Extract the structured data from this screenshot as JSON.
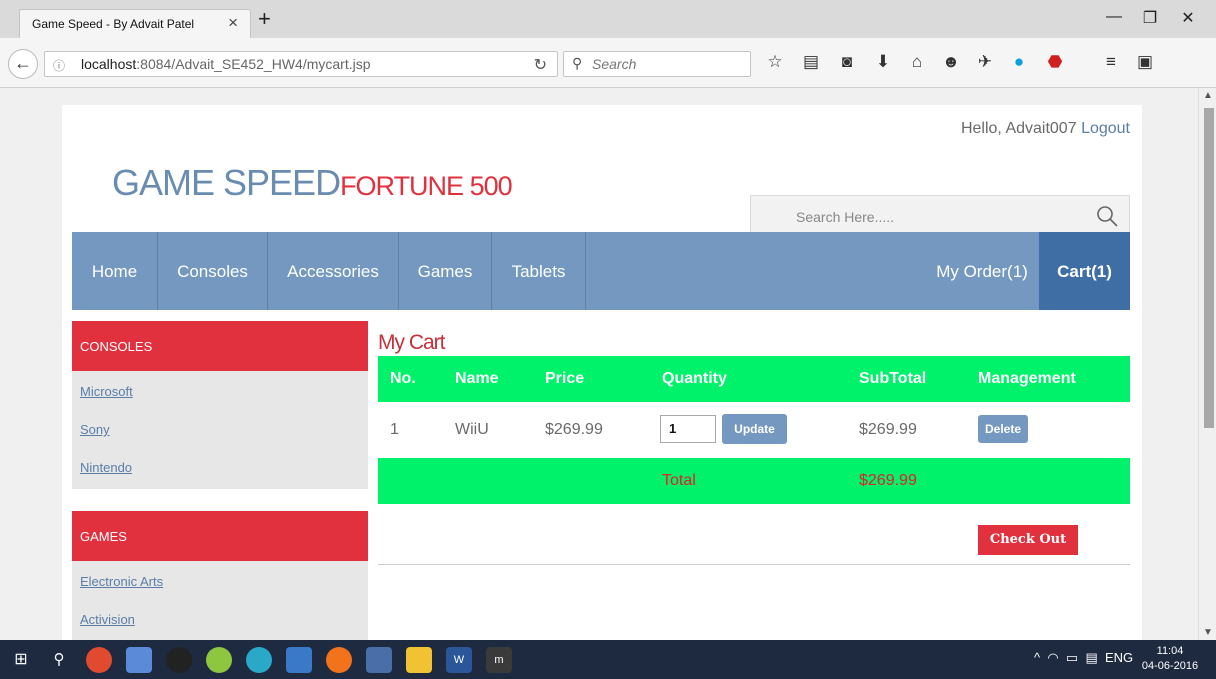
{
  "browser": {
    "tab_title": "Game Speed - By Advait Patel",
    "url_host": "localhost",
    "url_rest": ":8084/Advait_SE452_HW4/mycart.jsp",
    "search_placeholder": "Search"
  },
  "header": {
    "greeting": "Hello, Advait007",
    "logout": "Logout",
    "logo_main": "GAME SPEED",
    "logo_sub": "FORTUNE 500",
    "search_placeholder": "Search Here....."
  },
  "menu": {
    "items": [
      "Home",
      "Consoles",
      "Accessories",
      "Games",
      "Tablets"
    ],
    "my_order": "My Order(1)",
    "cart": "Cart(1)"
  },
  "sidebar": {
    "sections": [
      {
        "title": "CONSOLES",
        "links": [
          "Microsoft",
          "Sony",
          "Nintendo"
        ]
      },
      {
        "title": "GAMES",
        "links": [
          "Electronic Arts",
          "Activision"
        ]
      }
    ]
  },
  "cart": {
    "title": "My Cart",
    "columns": [
      "No.",
      "Name",
      "Price",
      "Quantity",
      "SubTotal",
      "Management"
    ],
    "items": [
      {
        "no": "1",
        "name": "WiiU",
        "price": "$269.99",
        "quantity": "1",
        "subtotal": "$269.99"
      }
    ],
    "update_label": "Update",
    "delete_label": "Delete",
    "total_label": "Total",
    "total_value": "$269.99",
    "checkout_label": "Check Out"
  },
  "taskbar": {
    "language": "ENG",
    "time": "11:04",
    "date": "04-06-2016"
  },
  "colors": {
    "accent_blue": "#7498bf",
    "accent_red": "#e2313e",
    "table_green": "#00f26b"
  }
}
